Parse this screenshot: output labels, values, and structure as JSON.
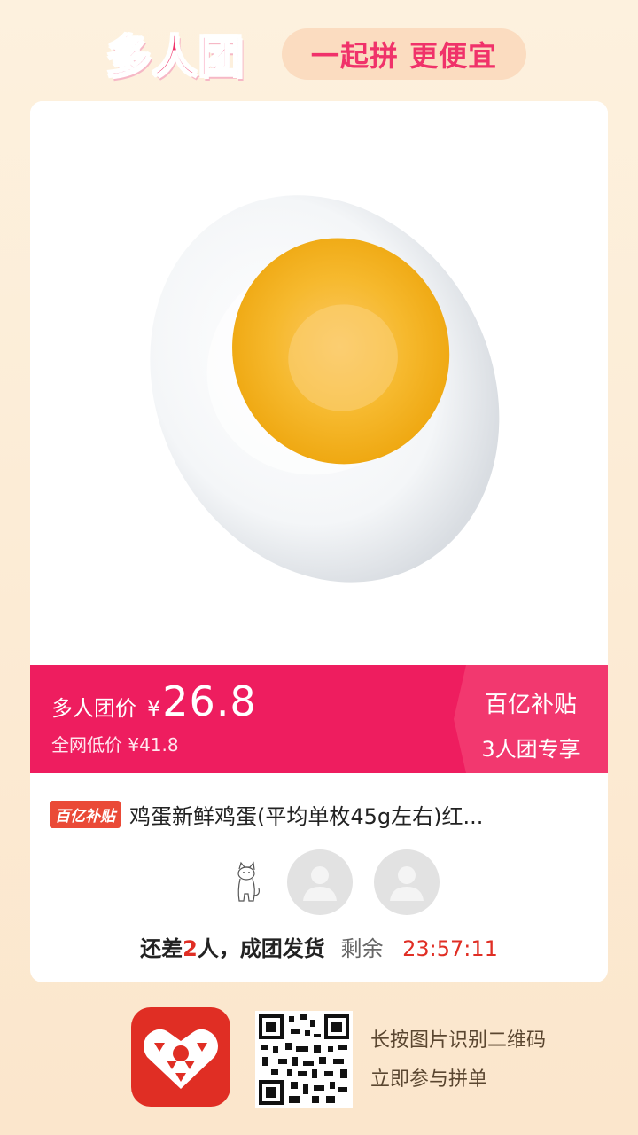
{
  "header": {
    "logo_text": "多人团",
    "slogan": "一起拼 更便宜"
  },
  "product": {
    "image_icon": "boiled-egg-image",
    "price_label": "多人团价",
    "currency": "¥",
    "price": "26.8",
    "original_price_text": "全网低价 ¥41.8",
    "subsidy_line1": "百亿补贴",
    "subsidy_line2": "3人团专享",
    "badge": "百亿补贴",
    "title": "鸡蛋新鲜鸡蛋(平均单枚45g左右)红..."
  },
  "group": {
    "status_prefix": "还差",
    "remaining_people": "2",
    "status_suffix": "人，成团发货",
    "remaining_label": "剩余",
    "countdown": "23:57:11"
  },
  "footer": {
    "app_icon": "pinduoduo-app-icon",
    "qr_icon": "qr-code",
    "line1": "长按图片识别二维码",
    "line2": "立即参与拼单"
  },
  "colors": {
    "brand_pink": "#ee1d5f",
    "accent_red": "#e02e24",
    "background": "#fdf1de"
  }
}
